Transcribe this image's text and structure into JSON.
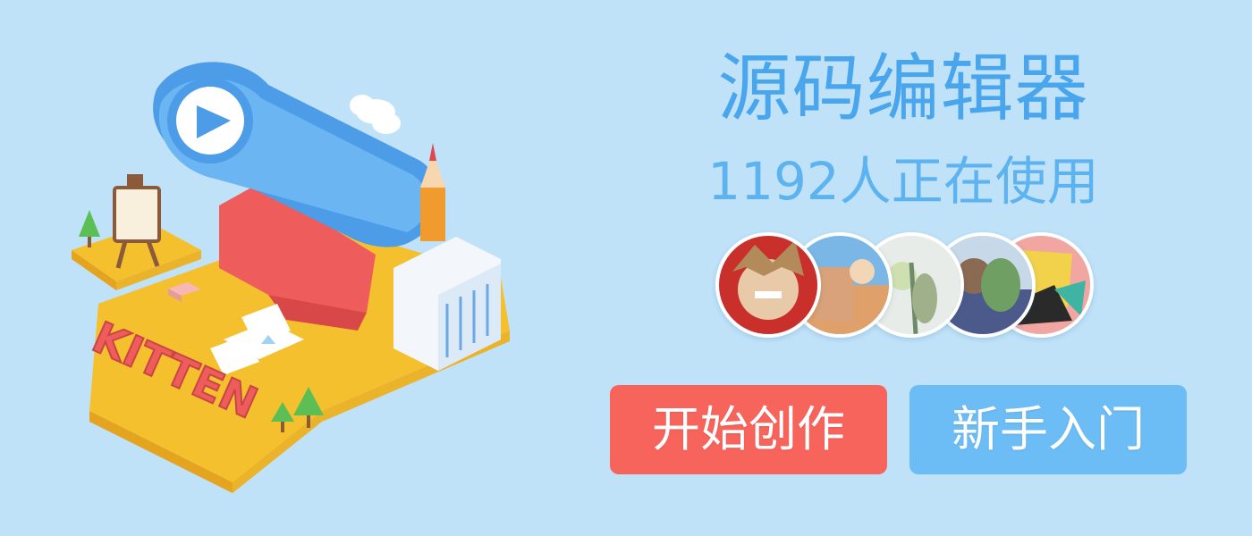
{
  "hero": {
    "title": "源码编辑器",
    "users_online": "1192人正在使用",
    "illustration_label": "KITTEN"
  },
  "avatars": [
    {
      "name": "user-avatar-1",
      "palette": [
        "#c9302c",
        "#e8c9a8",
        "#ffffff"
      ]
    },
    {
      "name": "user-avatar-2",
      "palette": [
        "#d9a27a",
        "#7ab6e6",
        "#f2d6b6"
      ]
    },
    {
      "name": "user-avatar-3",
      "palette": [
        "#9fb08a",
        "#e8ece8",
        "#6f8a6a"
      ]
    },
    {
      "name": "user-avatar-4",
      "palette": [
        "#6f9f63",
        "#8aa6d6",
        "#4b5a8a"
      ]
    },
    {
      "name": "user-avatar-5",
      "palette": [
        "#f2d24a",
        "#2a2a2a",
        "#3fb4a2"
      ]
    }
  ],
  "buttons": {
    "start_label": "开始创作",
    "guide_label": "新手入门"
  },
  "colors": {
    "background": "#bfe2f9",
    "title": "#4aa6ec",
    "start_button": "#f7645c",
    "guide_button": "#6cbcf5"
  }
}
